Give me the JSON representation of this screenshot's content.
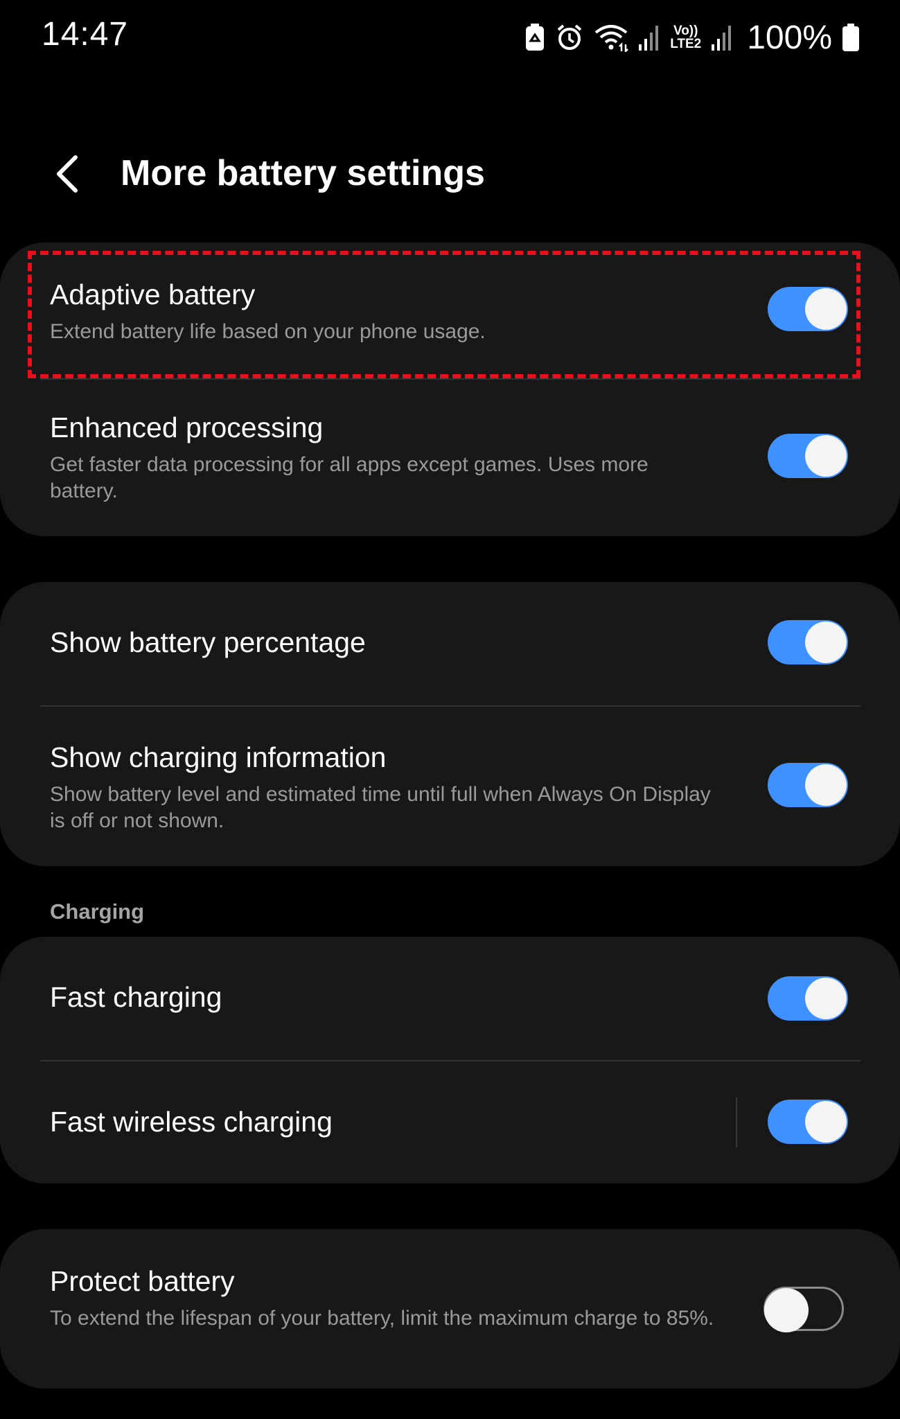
{
  "status_bar": {
    "time": "14:47",
    "battery_percent": "100%",
    "icons": [
      "battery-saver-icon",
      "alarm-icon",
      "wifi-icon",
      "signal-icon",
      "volte-lte2-icon",
      "signal-icon-2",
      "battery-icon"
    ],
    "network_label_top": "Vo))",
    "network_label_bottom": "LTE2"
  },
  "header": {
    "title": "More battery settings",
    "back_icon": "chevron-left-icon"
  },
  "groups": [
    {
      "items": [
        {
          "title": "Adaptive battery",
          "description": "Extend battery life based on your phone usage.",
          "enabled": true,
          "highlighted": true
        },
        {
          "title": "Enhanced processing",
          "description": "Get faster data processing for all apps except games. Uses more battery.",
          "enabled": true
        }
      ]
    },
    {
      "items": [
        {
          "title": "Show battery percentage",
          "description": "",
          "enabled": true
        },
        {
          "title": "Show charging information",
          "description": "Show battery level and estimated time until full when Always On Display is off or not shown.",
          "enabled": true
        }
      ]
    },
    {
      "label": "Charging",
      "items": [
        {
          "title": "Fast charging",
          "description": "",
          "enabled": true
        },
        {
          "title": "Fast wireless charging",
          "description": "",
          "enabled": true
        }
      ]
    },
    {
      "items": [
        {
          "title": "Protect battery",
          "description": "To extend the lifespan of your battery, limit the maximum charge to 85%.",
          "enabled": false
        }
      ]
    }
  ],
  "colors": {
    "background": "#000000",
    "card": "#181818",
    "accent": "#3e91ff",
    "highlight": "#e8101c",
    "secondary_text": "#9a9a9a"
  }
}
